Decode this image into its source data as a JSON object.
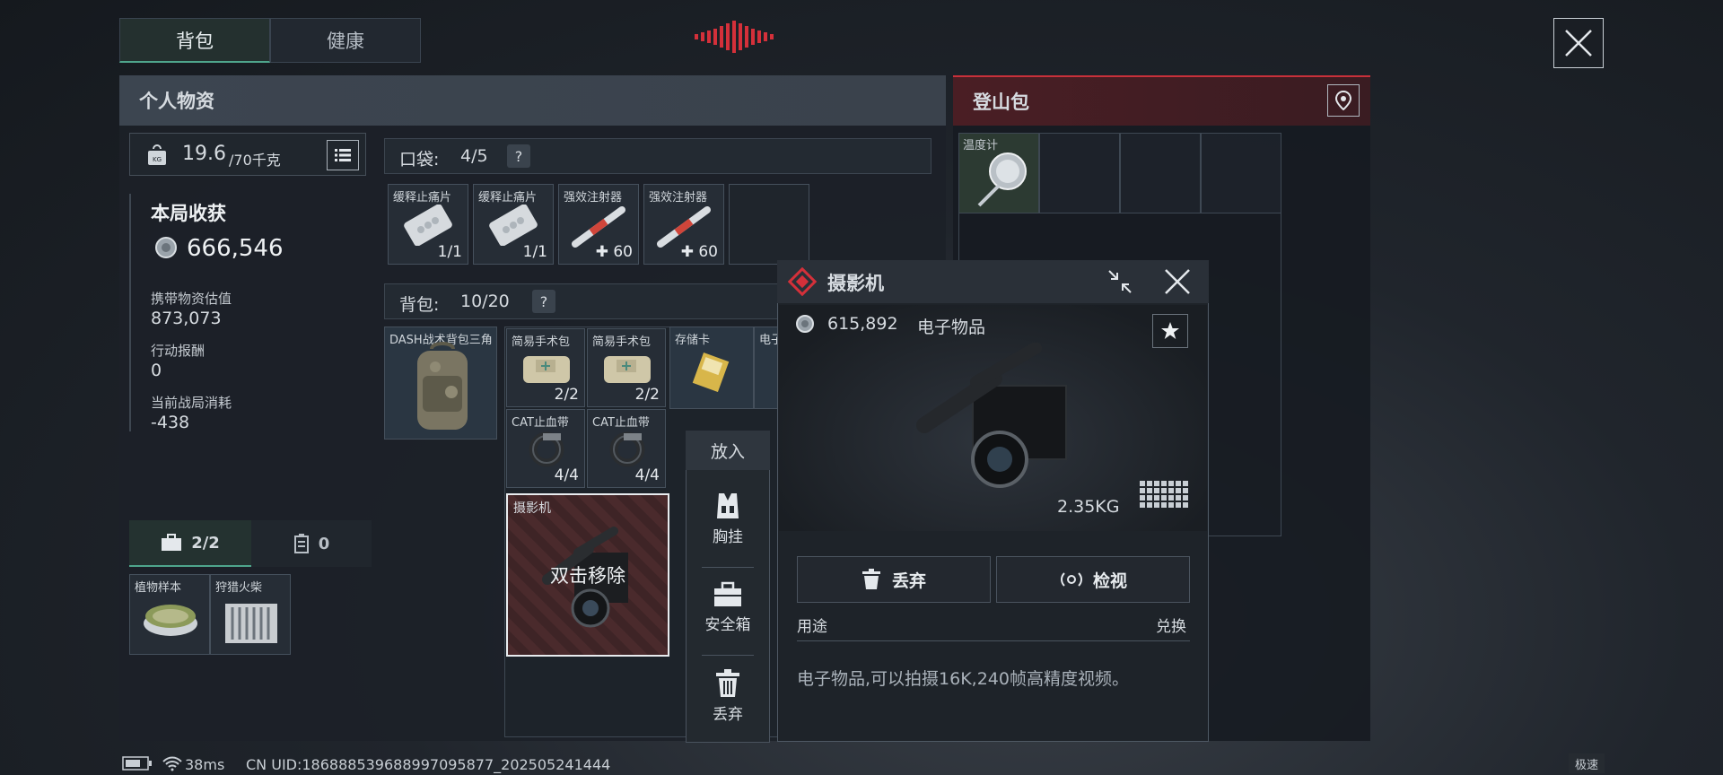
{
  "tabs": [
    {
      "label": "背包"
    },
    {
      "label": "健康"
    }
  ],
  "personal": {
    "title": "个人物资",
    "weight": "19.6",
    "weight_max": "/70千克"
  },
  "backpack_panel": {
    "title": "登山包"
  },
  "stats": {
    "round_loot_title": "本局收获",
    "round_loot_value": "666,546",
    "carry_label": "携带物资估值",
    "carry_value": "873,073",
    "reward_label": "行动报酬",
    "reward_value": "0",
    "consume_label": "当前战局消耗",
    "consume_value": "-438"
  },
  "pocket": {
    "label": "口袋:",
    "count": "4/5",
    "help": "?",
    "items": [
      {
        "label": "缓释止痛片",
        "count": "1/1"
      },
      {
        "label": "缓释止痛片",
        "count": "1/1"
      },
      {
        "label": "强效注射器",
        "count": "✚ 60"
      },
      {
        "label": "强效注射器",
        "count": "✚ 60"
      }
    ]
  },
  "bag": {
    "label": "背包:",
    "count": "10/20",
    "help": "?",
    "backpack_label": "DASH战术背包三角",
    "items": [
      {
        "label": "简易手术包",
        "count": "2/2"
      },
      {
        "label": "简易手术包",
        "count": "2/2"
      },
      {
        "label": "CAT止血带",
        "count": "4/4"
      },
      {
        "label": "CAT止血带",
        "count": "4/4"
      }
    ],
    "memcard_label": "存储卡",
    "elec_label": "电子",
    "camera_label": "摄影机",
    "camera_hint": "双击移除"
  },
  "safe_tabs": {
    "case_count": "2/2",
    "other_count": "0",
    "items": [
      {
        "label": "植物样本"
      },
      {
        "label": "狩猎火柴"
      }
    ]
  },
  "menu": {
    "title": "放入",
    "items": [
      {
        "label": "胸挂",
        "icon": "vest-icon"
      },
      {
        "label": "安全箱",
        "icon": "safebox-icon"
      },
      {
        "label": "丢弃",
        "icon": "trash-icon"
      }
    ]
  },
  "climb_bag": {
    "item_label": "温度计"
  },
  "detail": {
    "title": "摄影机",
    "value": "615,892",
    "category": "电子物品",
    "weight": "2.35KG",
    "discard": "丢弃",
    "inspect": "检视",
    "usage": "用途",
    "exchange": "兑换",
    "description": "电子物品,可以拍摄16K,240帧高精度视频。"
  },
  "status": {
    "ping": "38ms",
    "uid": "CN UID:1868885396889970958​77_202505241444",
    "mode": "极速"
  },
  "colors": {
    "accent_red": "#c8303a",
    "accent_green": "#4fa58c"
  }
}
